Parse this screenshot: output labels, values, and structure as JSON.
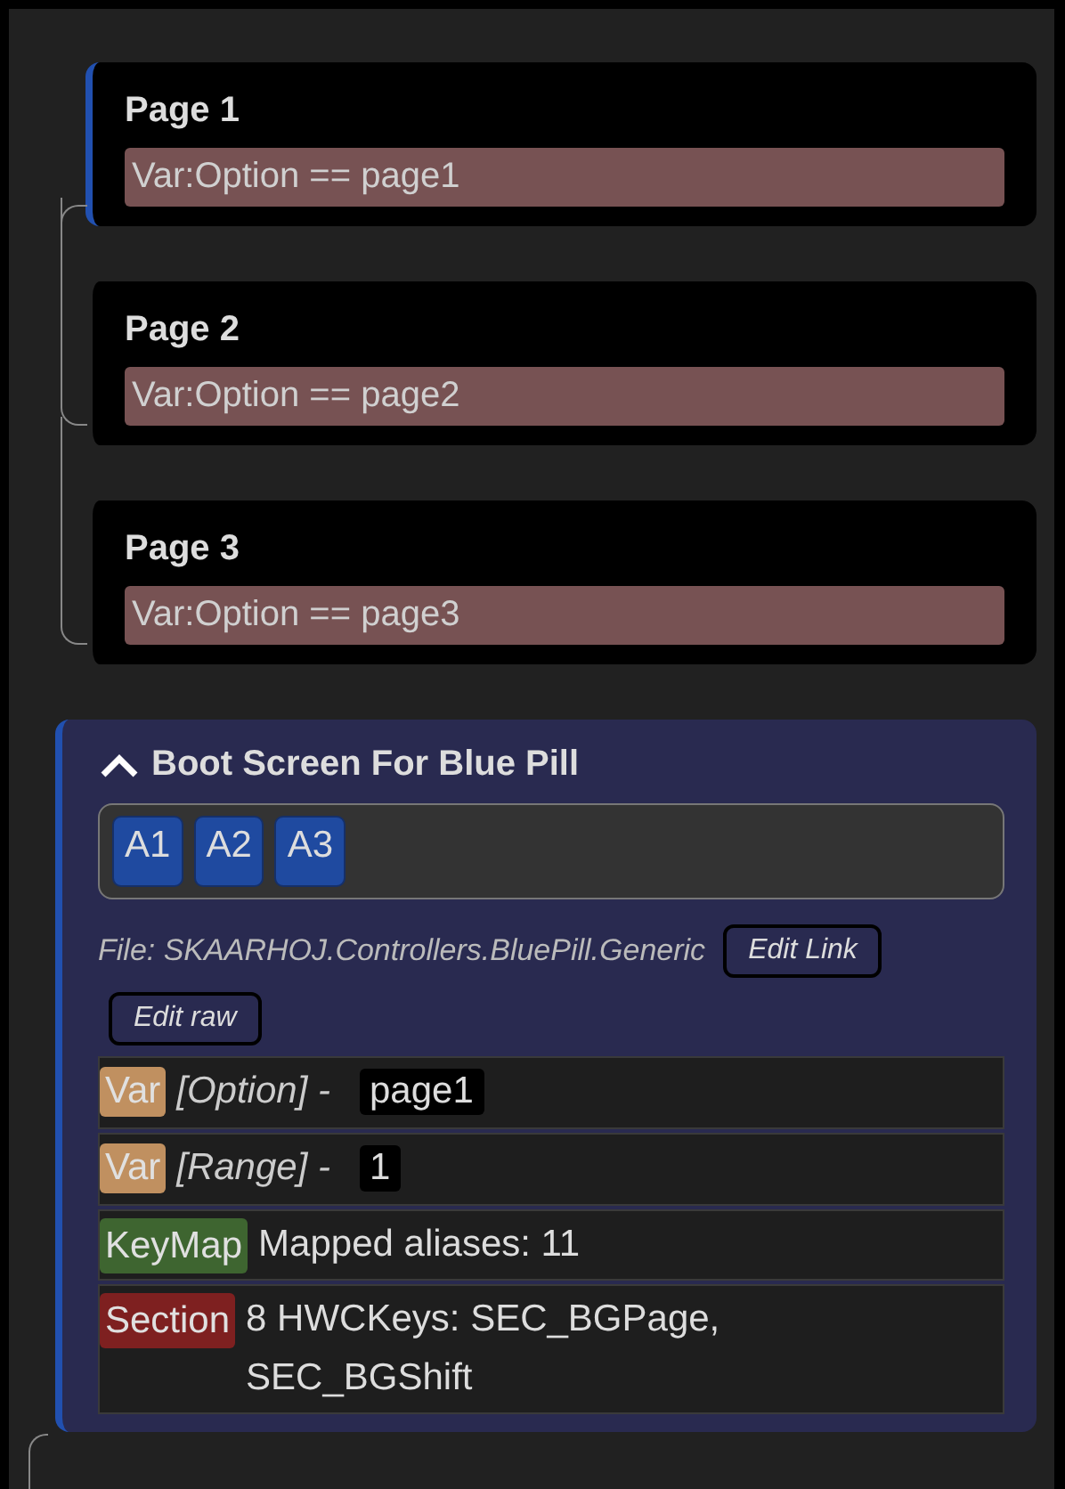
{
  "pages": [
    {
      "title": "Page 1",
      "condition": "Var:Option == page1",
      "selected": true
    },
    {
      "title": "Page 2",
      "condition": "Var:Option == page2",
      "selected": false
    },
    {
      "title": "Page 3",
      "condition": "Var:Option == page3",
      "selected": false
    }
  ],
  "group": {
    "title": "Boot Screen For Blue Pill",
    "expanded": true,
    "selected": true,
    "aliases": [
      "A1",
      "A2",
      "A3"
    ],
    "file": "File: SKAARHOJ.Controllers.BluePill.Generic",
    "buttons": [
      "Edit Link",
      "Edit raw"
    ],
    "rows": [
      {
        "kind": "var",
        "tag": "Var",
        "label": "[Option] -",
        "value": "page1"
      },
      {
        "kind": "var",
        "tag": "Var",
        "label": "[Range] -",
        "value": "1"
      },
      {
        "kind": "keymap",
        "tag": "KeyMap",
        "text": "Mapped aliases: 11"
      },
      {
        "kind": "section",
        "tag": "Section",
        "text": "8 HWCKeys: SEC_BGPage, SEC_BGShift"
      }
    ]
  }
}
